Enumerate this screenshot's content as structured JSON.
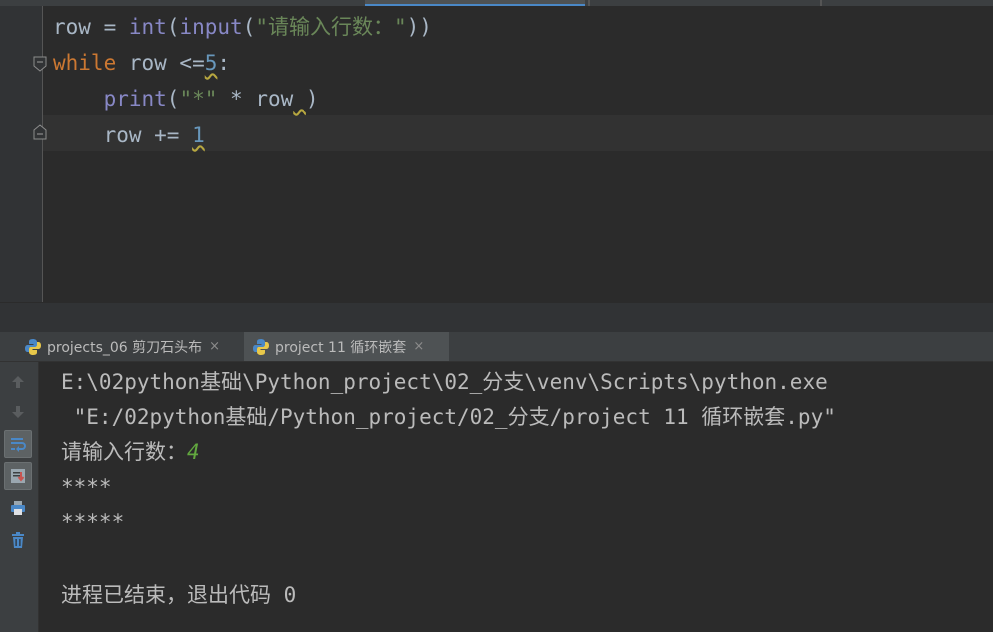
{
  "editor": {
    "lines": [
      [
        {
          "t": "row",
          "c": "id"
        },
        {
          "t": " = ",
          "c": "id"
        },
        {
          "t": "int",
          "c": "bi"
        },
        {
          "t": "(",
          "c": "id"
        },
        {
          "t": "input",
          "c": "bi"
        },
        {
          "t": "(",
          "c": "id"
        },
        {
          "t": "\"请输入行数：\"",
          "c": "str"
        },
        {
          "t": "))",
          "c": "id"
        }
      ],
      [
        {
          "t": "while",
          "c": "kw"
        },
        {
          "t": " row <=",
          "c": "id"
        },
        {
          "t": "5",
          "c": "num wavy"
        },
        {
          "t": ":",
          "c": "id"
        }
      ],
      [
        {
          "t": "    ",
          "c": "id"
        },
        {
          "t": "print",
          "c": "bi"
        },
        {
          "t": "(",
          "c": "id"
        },
        {
          "t": "\"*\"",
          "c": "str"
        },
        {
          "t": " * row",
          "c": "id"
        },
        {
          "t": " ",
          "c": "id wavy"
        },
        {
          "t": ")",
          "c": "id"
        }
      ],
      [
        {
          "t": "    row += ",
          "c": "id"
        },
        {
          "t": "1",
          "c": "num wavy"
        }
      ]
    ]
  },
  "run": {
    "tabs": [
      {
        "label": "projects_06 剪刀石头布",
        "close": "×"
      },
      {
        "label": "project 11 循环嵌套",
        "close": "×"
      }
    ],
    "console_lines": [
      "E:\\02python基础\\Python_project\\02_分支\\venv\\Scripts\\python.exe",
      " \"E:/02python基础/Python_project/02_分支/project 11 循环嵌套.py\"",
      "",
      "****",
      "*****",
      "",
      "进程已结束，退出代码 0"
    ],
    "prompt": "请输入行数：",
    "user_input": "4"
  },
  "toolbar_icons": [
    "up-arrow-icon",
    "down-arrow-icon",
    "soft-wrap-icon",
    "scroll-to-end-icon",
    "print-icon",
    "trash-icon"
  ],
  "colors": {
    "keyword": "#cc7832",
    "builtin": "#8888c6",
    "string": "#6a8759",
    "number": "#6897bb",
    "text": "#a9b7c6",
    "console_input": "#62a83f"
  }
}
